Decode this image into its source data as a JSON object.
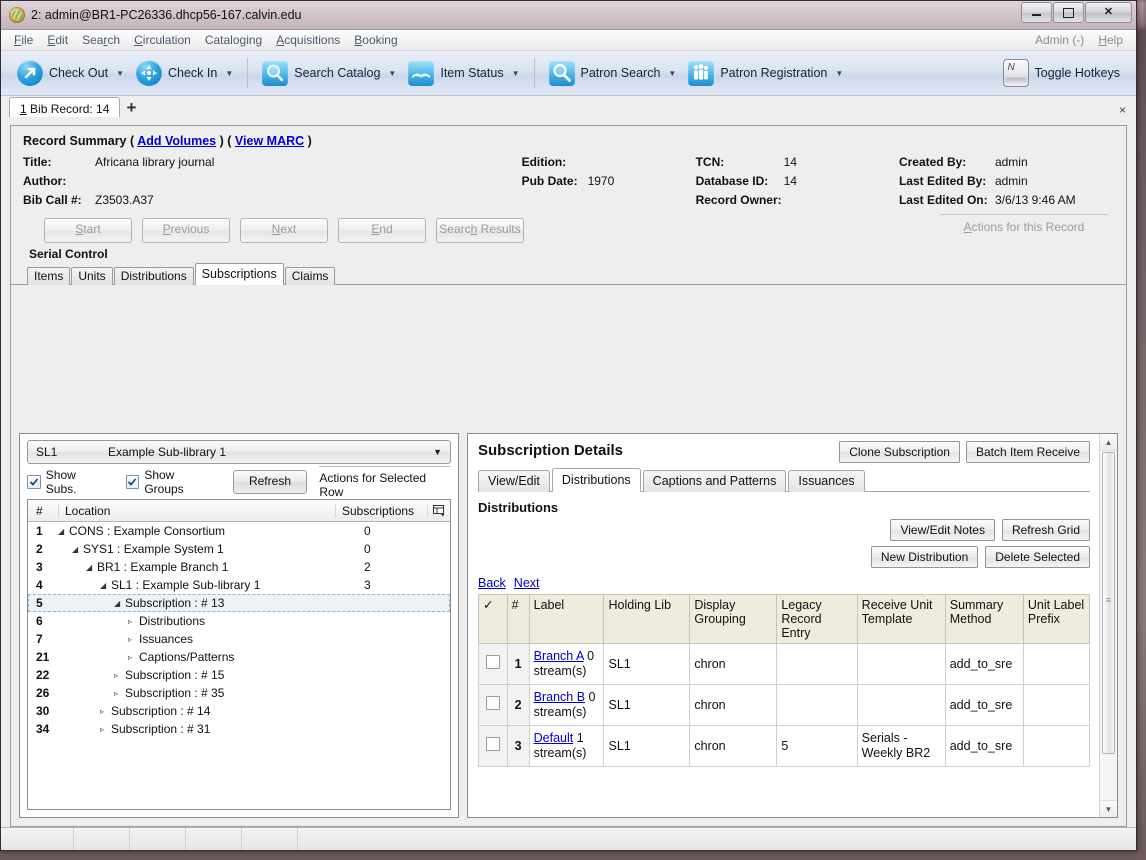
{
  "window": {
    "title": "2: admin@BR1-PC26336.dhcp56-167.calvin.edu",
    "app_icon": "evergreen-logo-icon",
    "minimize": "–",
    "maximize": "□",
    "close": "✕"
  },
  "menubar": {
    "items": [
      "File",
      "Edit",
      "Search",
      "Circulation",
      "Cataloging",
      "Acquisitions",
      "Booking"
    ],
    "right_items": [
      "Admin (-)",
      "Help"
    ]
  },
  "toolbar": {
    "buttons": [
      {
        "label": "Check Out",
        "icon": "check-out-icon",
        "has_caret": true
      },
      {
        "label": "Check In",
        "icon": "check-in-icon",
        "has_caret": true
      },
      {
        "label": "Search Catalog",
        "icon": "search-catalog-icon",
        "has_caret": true
      },
      {
        "label": "Item Status",
        "icon": "item-status-icon",
        "has_caret": true
      },
      {
        "label": "Patron Search",
        "icon": "patron-search-icon",
        "has_caret": true
      },
      {
        "label": "Patron Registration",
        "icon": "patron-registration-icon",
        "has_caret": true
      }
    ],
    "toggle_hotkeys": {
      "label": "Toggle Hotkeys",
      "icon": "keyboard-key-icon",
      "key_letter": "N"
    }
  },
  "tabstrip": {
    "tabs": [
      {
        "label": "1 Bib Record: 14"
      }
    ],
    "new_tab": "+",
    "close": "×"
  },
  "record_summary": {
    "heading": "Record Summary",
    "add_volumes": "Add Volumes",
    "view_marc": "View MARC",
    "paren_open": "(",
    "paren_mid": ") (",
    "paren_close": ")",
    "fields": [
      {
        "label": "Title:",
        "value": "Africana library journal"
      },
      {
        "label": "Author:",
        "value": ""
      },
      {
        "label": "Bib Call #:",
        "value": "Z3503.A37"
      },
      {
        "label": "Edition:",
        "value": ""
      },
      {
        "label": "Pub Date:",
        "value": "1970"
      },
      {
        "label": "TCN:",
        "value": "14"
      },
      {
        "label": "Database ID:",
        "value": "14"
      },
      {
        "label": "Record Owner:",
        "value": ""
      },
      {
        "label": "Created By:",
        "value": "admin"
      },
      {
        "label": "Last Edited By:",
        "value": "admin"
      },
      {
        "label": "Last Edited On:",
        "value": "3/6/13 9:46 AM"
      }
    ]
  },
  "nav": {
    "buttons": [
      "Start",
      "Previous",
      "Next",
      "End",
      "Search Results"
    ],
    "actions_for_record": "Actions for this Record"
  },
  "serial_control": {
    "heading": "Serial Control",
    "tabs": [
      "Items",
      "Units",
      "Distributions",
      "Subscriptions",
      "Claims"
    ],
    "active_tab": "Subscriptions"
  },
  "left_panel": {
    "org_selector": {
      "code": "SL1",
      "name": "Example Sub-library 1",
      "arrow": "▼"
    },
    "show_subs": {
      "label": "Show Subs.",
      "checked": true
    },
    "show_groups": {
      "label": "Show Groups",
      "checked": true
    },
    "refresh": "Refresh",
    "actions_selected_row": "Actions for Selected Row",
    "columns": [
      "#",
      "Location",
      "Subscriptions"
    ],
    "column_picker_icon": "column-picker-icon",
    "rows": [
      {
        "num": "1",
        "indent": 0,
        "twisty": "down",
        "label": "CONS : Example Consortium",
        "count": "0",
        "selected": false
      },
      {
        "num": "2",
        "indent": 1,
        "twisty": "down",
        "label": "SYS1 : Example System 1",
        "count": "0",
        "selected": false
      },
      {
        "num": "3",
        "indent": 2,
        "twisty": "down",
        "label": "BR1 : Example Branch 1",
        "count": "2",
        "selected": false
      },
      {
        "num": "4",
        "indent": 3,
        "twisty": "down",
        "label": "SL1 : Example Sub-library 1",
        "count": "3",
        "selected": false
      },
      {
        "num": "5",
        "indent": 4,
        "twisty": "down",
        "label": "Subscription : # 13",
        "count": "",
        "selected": true
      },
      {
        "num": "6",
        "indent": 5,
        "twisty": "right",
        "label": "Distributions",
        "count": "",
        "selected": false
      },
      {
        "num": "7",
        "indent": 5,
        "twisty": "right",
        "label": "Issuances",
        "count": "",
        "selected": false
      },
      {
        "num": "21",
        "indent": 5,
        "twisty": "right",
        "label": "Captions/Patterns",
        "count": "",
        "selected": false
      },
      {
        "num": "22",
        "indent": 4,
        "twisty": "right",
        "label": "Subscription : # 15",
        "count": "",
        "selected": false
      },
      {
        "num": "26",
        "indent": 4,
        "twisty": "right",
        "label": "Subscription : # 35",
        "count": "",
        "selected": false
      },
      {
        "num": "30",
        "indent": 3,
        "twisty": "right",
        "label": "Subscription : # 14",
        "count": "",
        "selected": false
      },
      {
        "num": "34",
        "indent": 3,
        "twisty": "right",
        "label": "Subscription : # 31",
        "count": "",
        "selected": false
      }
    ]
  },
  "right_panel": {
    "title": "Subscription Details",
    "clone_subscription": "Clone Subscription",
    "batch_item_receive": "Batch Item Receive",
    "tabs": [
      "View/Edit",
      "Distributions",
      "Captions and Patterns",
      "Issuances"
    ],
    "active_tab": "Distributions",
    "section_title": "Distributions",
    "view_edit_notes": "View/Edit Notes",
    "refresh_grid": "Refresh Grid",
    "new_distribution": "New Distribution",
    "delete_selected": "Delete Selected",
    "back": "Back",
    "next": "Next",
    "grid": {
      "columns": [
        "✓",
        "#",
        "Label",
        "Holding Lib",
        "Display Grouping",
        "Legacy Record Entry",
        "Receive Unit Template",
        "Summary Method",
        "Unit Label Prefix"
      ],
      "rows": [
        {
          "checked": false,
          "num": "1",
          "label_link": "Branch A",
          "label_sub": "0 stream(s)",
          "holding_lib": "SL1",
          "display_grouping": "chron",
          "legacy_record_entry": "",
          "receive_unit_template": "",
          "summary_method": "add_to_sre",
          "unit_label_prefix": ""
        },
        {
          "checked": false,
          "num": "2",
          "label_link": "Branch B",
          "label_sub": "0 stream(s)",
          "holding_lib": "SL1",
          "display_grouping": "chron",
          "legacy_record_entry": "",
          "receive_unit_template": "",
          "summary_method": "add_to_sre",
          "unit_label_prefix": ""
        },
        {
          "checked": false,
          "num": "3",
          "label_link": "Default",
          "label_sub": "1 stream(s)",
          "holding_lib": "SL1",
          "display_grouping": "chron",
          "legacy_record_entry": "5",
          "receive_unit_template": "Serials - Weekly BR2",
          "summary_method": "add_to_sre",
          "unit_label_prefix": ""
        }
      ]
    },
    "scrollbar": {
      "up": "▲",
      "down": "▼"
    }
  },
  "colors": {
    "link": "#0000cc",
    "grid_header_bg": "#efebdd",
    "selection_bg": "#eef2f5",
    "toolbar_icon_blue": "#1b8ccc"
  }
}
